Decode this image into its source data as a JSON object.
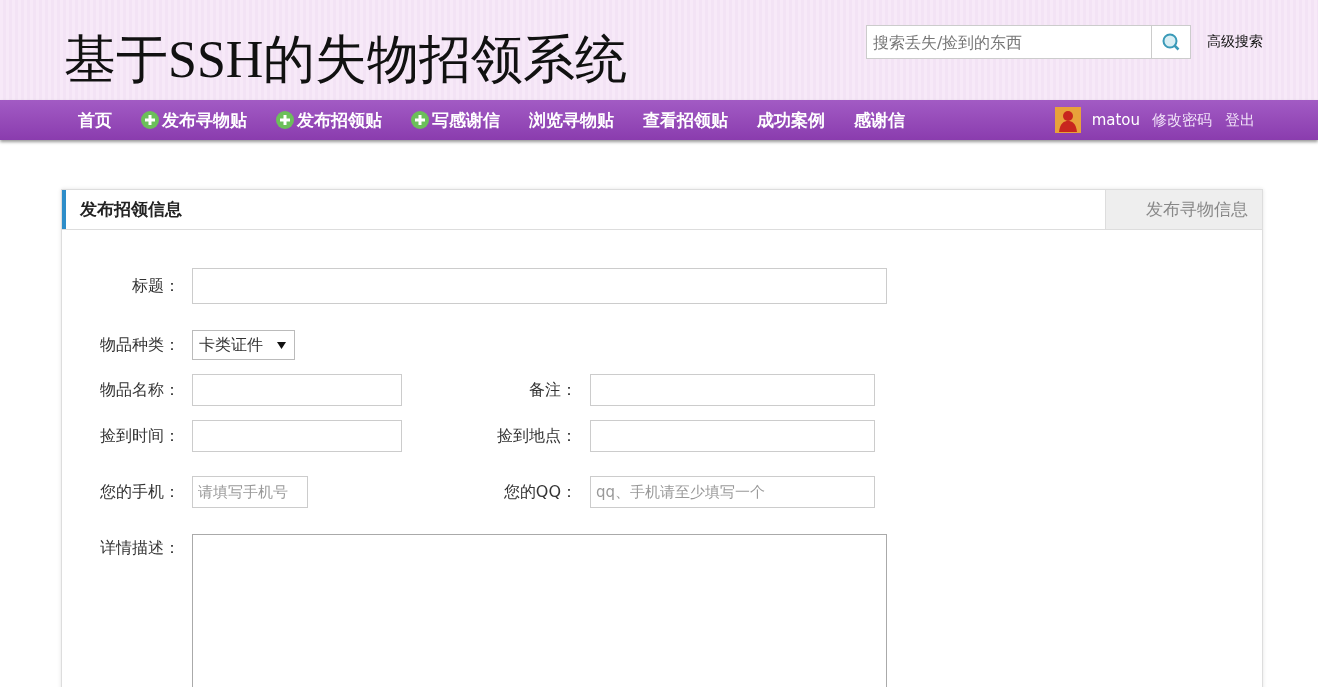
{
  "header": {
    "title": "基于SSH的失物招领系统",
    "search": {
      "placeholder": "搜索丢失/捡到的东西"
    },
    "advanced_search": "高级搜索"
  },
  "nav": {
    "items": [
      {
        "label": "首页",
        "plus": false
      },
      {
        "label": "发布寻物贴",
        "plus": true
      },
      {
        "label": "发布招领贴",
        "plus": true
      },
      {
        "label": "写感谢信",
        "plus": true
      },
      {
        "label": "浏览寻物贴",
        "plus": false
      },
      {
        "label": "查看招领贴",
        "plus": false
      },
      {
        "label": "成功案例",
        "plus": false
      },
      {
        "label": "感谢信",
        "plus": false
      }
    ],
    "user": "matou",
    "links": [
      "修改密码",
      "登出"
    ]
  },
  "panel": {
    "tabs": [
      {
        "label": "发布招领信息",
        "selected": true
      },
      {
        "label": "发布寻物信息",
        "selected": false
      }
    ],
    "form": {
      "title_label": "标题：",
      "category_label": "物品种类：",
      "category_value": "卡类证件",
      "rows": [
        {
          "label": "物品名称：",
          "label2": "备注："
        },
        {
          "label": "捡到时间：",
          "label2": "捡到地点："
        },
        {
          "label": "您的手机：",
          "placeholder": "请填写手机号",
          "label2": "您的QQ：",
          "placeholder2": "qq、手机请至少填写一个"
        }
      ],
      "description_label": "详情描述："
    }
  }
}
